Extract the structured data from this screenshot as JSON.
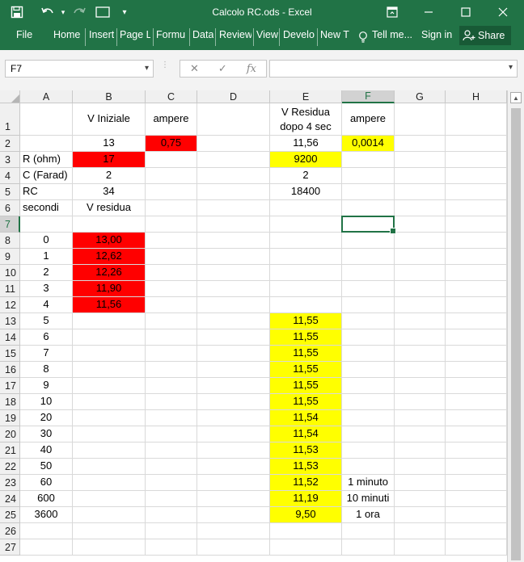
{
  "window": {
    "title": "Calcolo RC.ods - Excel",
    "tell_me": "Tell me...",
    "sign_in": "Sign in",
    "share": "Share"
  },
  "ribbon_tabs": [
    "File",
    "Home",
    "Insert",
    "Page L",
    "Formu",
    "Data",
    "Review",
    "View",
    "Develo",
    "New T"
  ],
  "formula_bar": {
    "name_box": "F7",
    "formula": ""
  },
  "colors": {
    "accent": "#217346",
    "red_fill": "#ff0000",
    "yellow_fill": "#ffff00"
  },
  "columns": [
    "A",
    "B",
    "C",
    "D",
    "E",
    "F",
    "G",
    "H"
  ],
  "rows": [
    "1",
    "2",
    "3",
    "4",
    "5",
    "6",
    "7",
    "8",
    "9",
    "10",
    "11",
    "12",
    "13",
    "14",
    "15",
    "16",
    "17",
    "18",
    "19",
    "20",
    "21",
    "22",
    "23",
    "24",
    "25",
    "26",
    "27"
  ],
  "selected_cell": "F7",
  "cells": [
    {
      "r": 1,
      "c": "B",
      "v": "V Iniziale",
      "align": "center"
    },
    {
      "r": 1,
      "c": "C",
      "v": "ampere",
      "align": "center"
    },
    {
      "r": 1,
      "c": "E",
      "v": "V Residua",
      "v2": "dopo 4 sec",
      "align": "center"
    },
    {
      "r": 1,
      "c": "F",
      "v": "ampere",
      "align": "center"
    },
    {
      "r": 2,
      "c": "B",
      "v": "13",
      "align": "center"
    },
    {
      "r": 2,
      "c": "C",
      "v": "0,75",
      "align": "center",
      "fill": "red"
    },
    {
      "r": 2,
      "c": "E",
      "v": "11,56",
      "align": "center"
    },
    {
      "r": 2,
      "c": "F",
      "v": "0,0014",
      "align": "center",
      "fill": "yellow"
    },
    {
      "r": 3,
      "c": "A",
      "v": "R (ohm)",
      "align": "left"
    },
    {
      "r": 3,
      "c": "B",
      "v": "17",
      "align": "center",
      "fill": "red"
    },
    {
      "r": 3,
      "c": "E",
      "v": "9200",
      "align": "center",
      "fill": "yellow"
    },
    {
      "r": 4,
      "c": "A",
      "v": "C (Farad)",
      "align": "left"
    },
    {
      "r": 4,
      "c": "B",
      "v": "2",
      "align": "center"
    },
    {
      "r": 4,
      "c": "E",
      "v": "2",
      "align": "center"
    },
    {
      "r": 5,
      "c": "A",
      "v": "RC",
      "align": "left"
    },
    {
      "r": 5,
      "c": "B",
      "v": "34",
      "align": "center"
    },
    {
      "r": 5,
      "c": "E",
      "v": "18400",
      "align": "center"
    },
    {
      "r": 6,
      "c": "A",
      "v": "secondi",
      "align": "left"
    },
    {
      "r": 6,
      "c": "B",
      "v": "V residua",
      "align": "center"
    },
    {
      "r": 8,
      "c": "A",
      "v": "0",
      "align": "center"
    },
    {
      "r": 8,
      "c": "B",
      "v": "13,00",
      "align": "center",
      "fill": "red"
    },
    {
      "r": 9,
      "c": "A",
      "v": "1",
      "align": "center"
    },
    {
      "r": 9,
      "c": "B",
      "v": "12,62",
      "align": "center",
      "fill": "red"
    },
    {
      "r": 10,
      "c": "A",
      "v": "2",
      "align": "center"
    },
    {
      "r": 10,
      "c": "B",
      "v": "12,26",
      "align": "center",
      "fill": "red"
    },
    {
      "r": 11,
      "c": "A",
      "v": "3",
      "align": "center"
    },
    {
      "r": 11,
      "c": "B",
      "v": "11,90",
      "align": "center",
      "fill": "red"
    },
    {
      "r": 12,
      "c": "A",
      "v": "4",
      "align": "center"
    },
    {
      "r": 12,
      "c": "B",
      "v": "11,56",
      "align": "center",
      "fill": "red"
    },
    {
      "r": 13,
      "c": "A",
      "v": "5",
      "align": "center"
    },
    {
      "r": 13,
      "c": "E",
      "v": "11,55",
      "align": "center",
      "fill": "yellow"
    },
    {
      "r": 14,
      "c": "A",
      "v": "6",
      "align": "center"
    },
    {
      "r": 14,
      "c": "E",
      "v": "11,55",
      "align": "center",
      "fill": "yellow"
    },
    {
      "r": 15,
      "c": "A",
      "v": "7",
      "align": "center"
    },
    {
      "r": 15,
      "c": "E",
      "v": "11,55",
      "align": "center",
      "fill": "yellow"
    },
    {
      "r": 16,
      "c": "A",
      "v": "8",
      "align": "center"
    },
    {
      "r": 16,
      "c": "E",
      "v": "11,55",
      "align": "center",
      "fill": "yellow"
    },
    {
      "r": 17,
      "c": "A",
      "v": "9",
      "align": "center"
    },
    {
      "r": 17,
      "c": "E",
      "v": "11,55",
      "align": "center",
      "fill": "yellow"
    },
    {
      "r": 18,
      "c": "A",
      "v": "10",
      "align": "center"
    },
    {
      "r": 18,
      "c": "E",
      "v": "11,55",
      "align": "center",
      "fill": "yellow"
    },
    {
      "r": 19,
      "c": "A",
      "v": "20",
      "align": "center"
    },
    {
      "r": 19,
      "c": "E",
      "v": "11,54",
      "align": "center",
      "fill": "yellow"
    },
    {
      "r": 20,
      "c": "A",
      "v": "30",
      "align": "center"
    },
    {
      "r": 20,
      "c": "E",
      "v": "11,54",
      "align": "center",
      "fill": "yellow"
    },
    {
      "r": 21,
      "c": "A",
      "v": "40",
      "align": "center"
    },
    {
      "r": 21,
      "c": "E",
      "v": "11,53",
      "align": "center",
      "fill": "yellow"
    },
    {
      "r": 22,
      "c": "A",
      "v": "50",
      "align": "center"
    },
    {
      "r": 22,
      "c": "E",
      "v": "11,53",
      "align": "center",
      "fill": "yellow"
    },
    {
      "r": 23,
      "c": "A",
      "v": "60",
      "align": "center"
    },
    {
      "r": 23,
      "c": "E",
      "v": "11,52",
      "align": "center",
      "fill": "yellow"
    },
    {
      "r": 23,
      "c": "F",
      "v": "1 minuto",
      "align": "center"
    },
    {
      "r": 24,
      "c": "A",
      "v": "600",
      "align": "center"
    },
    {
      "r": 24,
      "c": "E",
      "v": "11,19",
      "align": "center",
      "fill": "yellow"
    },
    {
      "r": 24,
      "c": "F",
      "v": "10 minuti",
      "align": "center"
    },
    {
      "r": 25,
      "c": "A",
      "v": "3600",
      "align": "center"
    },
    {
      "r": 25,
      "c": "E",
      "v": "9,50",
      "align": "center",
      "fill": "yellow"
    },
    {
      "r": 25,
      "c": "F",
      "v": "1 ora",
      "align": "center"
    }
  ]
}
